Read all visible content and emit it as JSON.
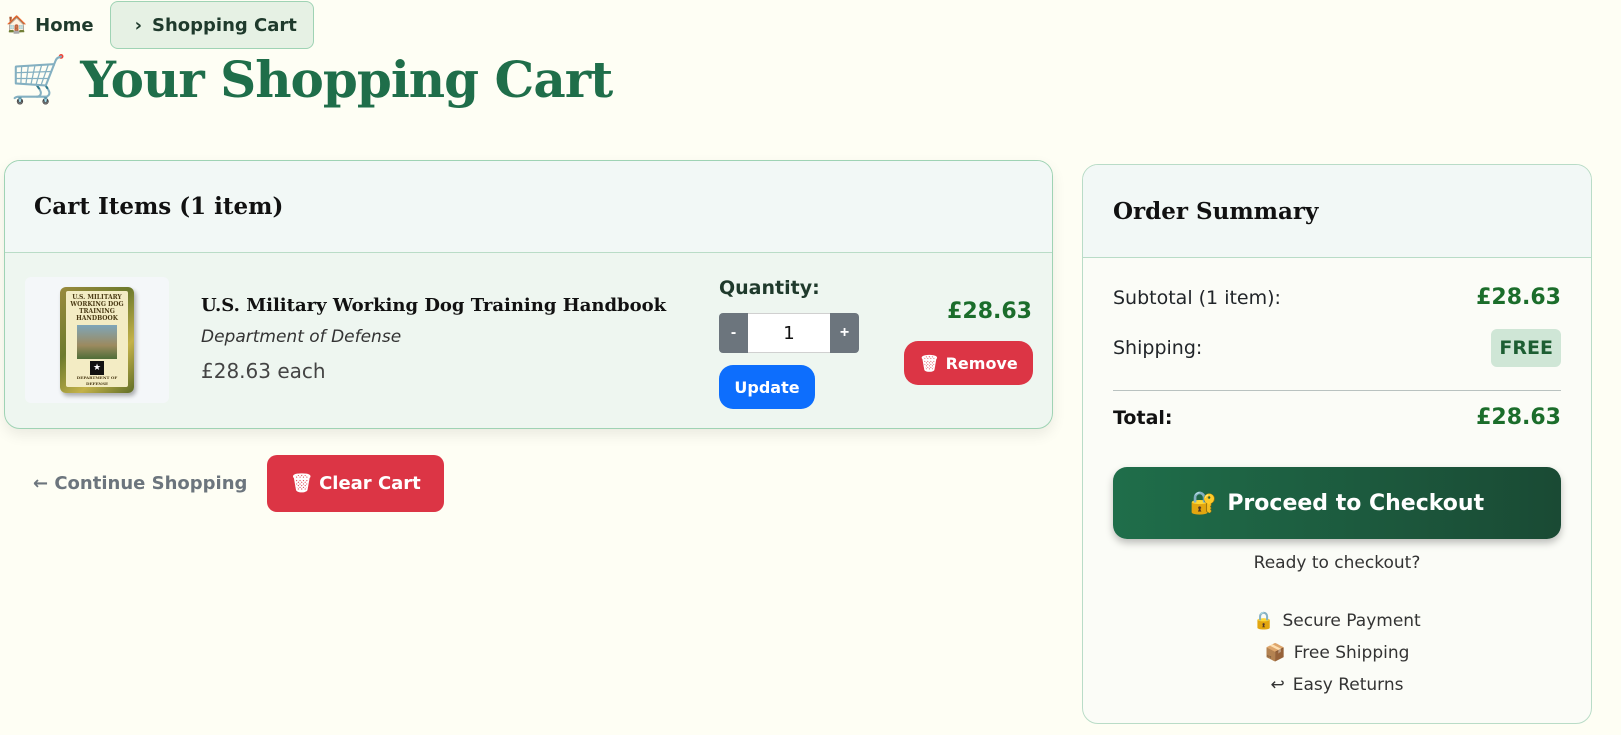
{
  "breadcrumb": {
    "home_icon": "house-icon",
    "home_label": "Home",
    "separator_icon": "chevron-right-icon",
    "current_label": "Shopping Cart"
  },
  "page": {
    "title_icon": "shopping-cart-icon",
    "title": "Your Shopping Cart"
  },
  "cart": {
    "header": "Cart Items (1 item)",
    "items": [
      {
        "title": "U.S. Military Working Dog Training Handbook",
        "author": "Department of Defense",
        "each_price": "£28.63 each",
        "quantity_label": "Quantity:",
        "quantity": "1",
        "minus_label": "-",
        "plus_label": "+",
        "update_label": "Update",
        "line_total": "£28.63",
        "remove_label": "Remove",
        "remove_icon": "wastebasket-icon",
        "cover": {
          "line1": "U.S. MILITARY",
          "line2": "WORKING DOG TRAINING",
          "line3": "HANDBOOK",
          "footer": "DEPARTMENT OF DEFENSE"
        }
      }
    ],
    "continue_label": "← Continue Shopping",
    "clear_label": "Clear Cart",
    "clear_icon": "wastebasket-icon"
  },
  "summary": {
    "header": "Order Summary",
    "subtotal_label": "Subtotal (1 item):",
    "subtotal_value": "£28.63",
    "shipping_label": "Shipping:",
    "shipping_value": "FREE",
    "total_label": "Total:",
    "total_value": "£28.63",
    "checkout_label": "Proceed to Checkout",
    "checkout_icon": "lock-key-icon",
    "ready_text": "Ready to checkout?",
    "perks": [
      {
        "icon": "lock-icon",
        "label": "Secure Payment"
      },
      {
        "icon": "package-icon",
        "label": "Free Shipping"
      },
      {
        "icon": "return-arrow-icon",
        "label": "Easy Returns"
      }
    ]
  },
  "colors": {
    "background": "#fefef4",
    "brand_green": "#1f6e4a",
    "price_green": "#1b6d2b",
    "danger": "#dc3545",
    "primary": "#0d6efd",
    "secondary": "#6c757d"
  }
}
